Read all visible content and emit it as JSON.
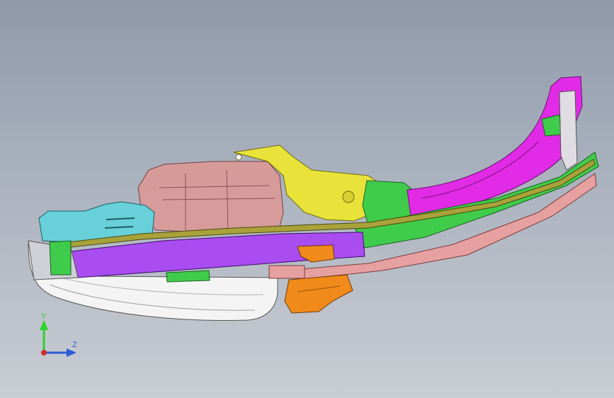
{
  "viewport": {
    "background_top": "#8f99aa",
    "background_bottom": "#c9cdd4"
  },
  "model": {
    "description_icon": "car-front-floor-structure-3d-model",
    "parts": [
      {
        "name": "bumper-cover",
        "color": "#f4f4f4"
      },
      {
        "name": "crash-box",
        "color": "#67d0d8"
      },
      {
        "name": "side-rail-purple",
        "color": "#a94cf0"
      },
      {
        "name": "dash-panel-pink",
        "color": "#d99a98"
      },
      {
        "name": "cowl-yellow",
        "color": "#e8e23a"
      },
      {
        "name": "wheelhouse-magenta",
        "color": "#e12be6"
      },
      {
        "name": "rocker-green",
        "color": "#3fcc4a"
      },
      {
        "name": "subframe-bracket-orange",
        "color": "#f08a1a"
      },
      {
        "name": "lower-rail-salmon",
        "color": "#e6a0a0"
      }
    ]
  },
  "triad": {
    "y_label": "Y",
    "z_label": "Z",
    "y_color": "#2bd12b",
    "z_color": "#2a5bd6",
    "x_color": "#d12b2b"
  }
}
